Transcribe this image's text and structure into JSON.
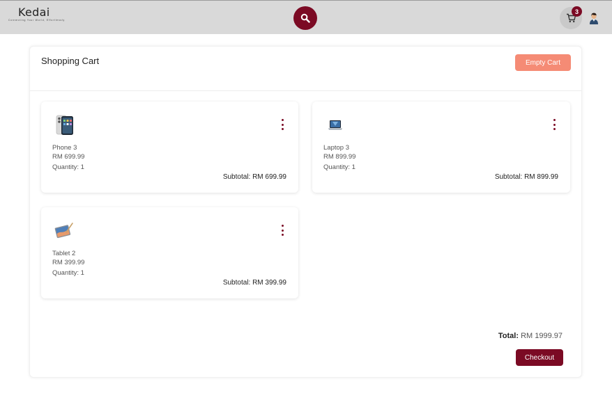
{
  "header": {
    "logo_name": "Kedai",
    "logo_tagline": "Connecting Your World, Effortlessly",
    "cart_count": "3"
  },
  "cart": {
    "title": "Shopping Cart",
    "empty_label": "Empty Cart",
    "items": [
      {
        "name": "Phone 3",
        "price": "RM 699.99",
        "quantity": "Quantity: 1",
        "subtotal": "Subtotal: RM 699.99",
        "icon": "phone-icon"
      },
      {
        "name": "Laptop 3",
        "price": "RM 899.99",
        "quantity": "Quantity: 1",
        "subtotal": "Subtotal: RM 899.99",
        "icon": "laptop-icon"
      },
      {
        "name": "Tablet 2",
        "price": "RM 399.99",
        "quantity": "Quantity: 1",
        "subtotal": "Subtotal: RM 399.99",
        "icon": "tablet-icon"
      }
    ],
    "total_label": "Total:",
    "total_value": "RM 1999.97",
    "checkout_label": "Checkout"
  },
  "colors": {
    "brand": "#7b0a24",
    "empty_button": "#f58b75",
    "topbar": "#d9d9d9"
  }
}
